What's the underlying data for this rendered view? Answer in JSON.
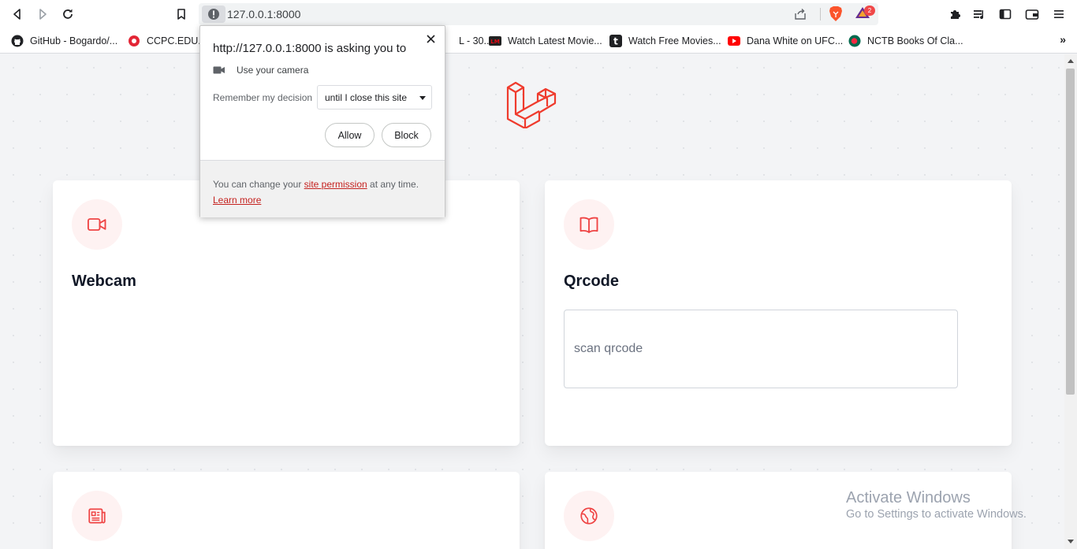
{
  "browser": {
    "url": "127.0.0.1:8000",
    "rewards_count": "2",
    "bookmarks": [
      {
        "label": "GitHub - Bogardo/...",
        "icon": "github-icon"
      },
      {
        "label": "CCPC.EDU.BD",
        "icon": "ccpc-icon"
      },
      {
        "label": "L - 30...",
        "icon": "page-icon"
      },
      {
        "label": "Watch Latest Movie...",
        "icon": "movie-icon"
      },
      {
        "label": "Watch Free Movies...",
        "icon": "t-icon"
      },
      {
        "label": "Dana White on UFC...",
        "icon": "youtube-icon"
      },
      {
        "label": "NCTB Books Of Cla...",
        "icon": "nctb-icon"
      }
    ],
    "bookmarks_more": "»"
  },
  "permission_popup": {
    "title": "http://127.0.0.1:8000 is asking you to",
    "permission": "Use your camera",
    "remember_label": "Remember my decision",
    "remember_value": "until I close this site",
    "allow_label": "Allow",
    "block_label": "Block",
    "footer_prefix": "You can change your",
    "footer_link": "site permission",
    "footer_suffix": "at any time.",
    "learn_more": "Learn more"
  },
  "cards": {
    "webcam": {
      "title": "Webcam",
      "icon": "video-camera-icon"
    },
    "qrcode": {
      "title": "Qrcode",
      "icon": "book-open-icon",
      "placeholder": "scan qrcode"
    },
    "third": {
      "icon": "newspaper-icon"
    },
    "fourth": {
      "icon": "globe-icon"
    }
  },
  "watermark": {
    "line1": "Activate Windows",
    "line2": "Go to Settings to activate Windows."
  },
  "colors": {
    "accent": "#ef4444",
    "icon_bg": "#fef2f2",
    "page_bg": "#f3f4f6"
  }
}
